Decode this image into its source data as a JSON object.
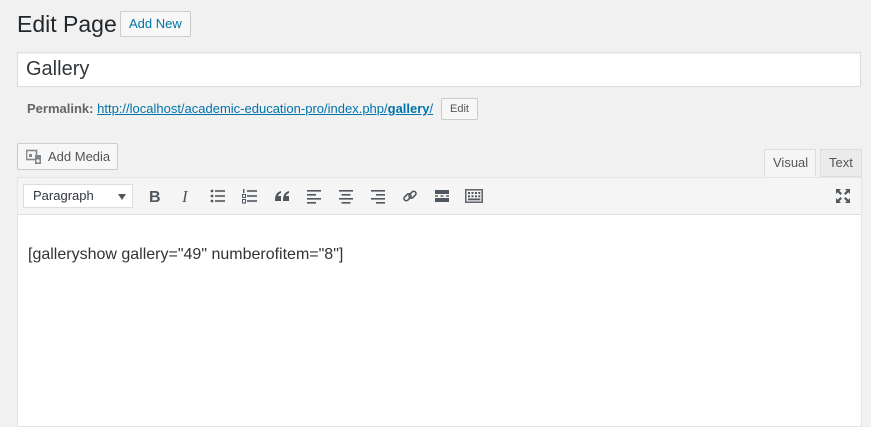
{
  "header": {
    "title": "Edit Page",
    "add_new_label": "Add New"
  },
  "post": {
    "title_value": "Gallery"
  },
  "permalink": {
    "label": "Permalink:",
    "url_base": "http://localhost/academic-education-pro/index.php/",
    "slug": "gallery",
    "url_tail": "/",
    "edit_label": "Edit"
  },
  "media": {
    "add_media_label": "Add Media"
  },
  "editor_tabs": {
    "visual": "Visual",
    "text": "Text",
    "active": "Visual"
  },
  "toolbar": {
    "format_selected": "Paragraph",
    "buttons": [
      "bold-icon",
      "italic-icon",
      "bulleted-list-icon",
      "numbered-list-icon",
      "blockquote-icon",
      "align-left-icon",
      "align-center-icon",
      "align-right-icon",
      "link-icon",
      "read-more-icon",
      "toolbar-toggle-icon",
      "fullscreen-icon"
    ]
  },
  "editor": {
    "content": "[galleryshow gallery=\"49\" numberofitem=\"8\"]"
  },
  "colors": {
    "link": "#0073aa",
    "background": "#f1f1f1",
    "text": "#23282d"
  }
}
